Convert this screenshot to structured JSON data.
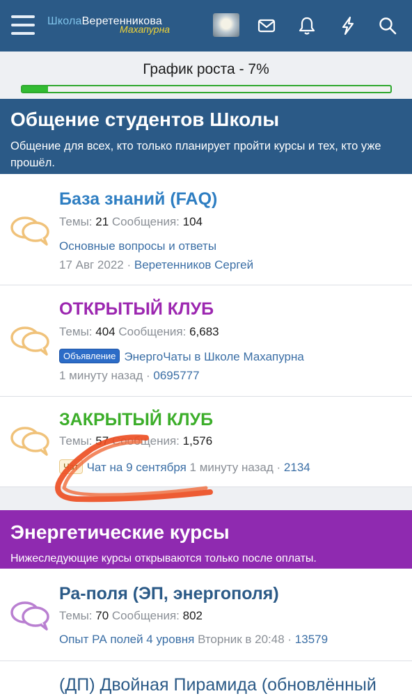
{
  "header": {
    "logo_part1": "Школа",
    "logo_part2": "Веретенникова",
    "logo_sub": "Махапурна",
    "icons": [
      "menu-icon",
      "avatar",
      "mail-icon",
      "bell-icon",
      "lightning-icon",
      "search-icon"
    ]
  },
  "progress": {
    "label": "График роста - 7%",
    "percent": 7
  },
  "section1": {
    "title": "Общение студентов Школы",
    "description": "Общение для всех, кто только планирует пройти курсы и тех, кто уже прошёл."
  },
  "section2": {
    "title": "Энергетические курсы",
    "description": "Нижеследующие курсы открываются только после оплаты."
  },
  "stat_labels": {
    "threads": "Темы:",
    "messages": "Сообщения:"
  },
  "forums": [
    {
      "title": "База знаний (FAQ)",
      "title_color": "#2e7ec2",
      "threads": "21",
      "messages": "104",
      "last_thread": "Основные вопросы и ответы",
      "last_date": "17 Авг 2022",
      "last_user": "Веретенников Сергей"
    },
    {
      "title": "ОТКРЫТЫЙ КЛУБ",
      "title_color": "#9c27b0",
      "threads": "404",
      "messages": "6,683",
      "prefix": "Объявление",
      "last_thread": "ЭнергоЧаты в Школе Махапурна",
      "last_date": "1 минуту назад",
      "last_user": "0695777"
    },
    {
      "title": "ЗАКРЫТЫЙ КЛУБ",
      "title_color": "#3cae2a",
      "threads": "57",
      "messages": "1,576",
      "prefix": "Чат",
      "last_thread": "Чат на 9 сентября",
      "last_date": "1 минуту назад",
      "last_user": "2134"
    },
    {
      "title": "Ра-поля (ЭП, энергополя)",
      "title_color": "#2b5a87",
      "threads": "70",
      "messages": "802",
      "last_thread": "Опыт РА полей 4 уровня",
      "last_date": "Вторник в 20:48",
      "last_user": "13579"
    },
    {
      "title": "(ДП) Двойная Пирамида (обновлённый",
      "title_color": "#2b5a87"
    }
  ],
  "colors": {
    "header_bg": "#2b5a87",
    "section2_bg": "#8f2ab0",
    "progress_green": "#32bc32",
    "icon_orange": "#f0c27a",
    "icon_purple": "#b97fd1",
    "scribble": "#ec4b1f"
  }
}
